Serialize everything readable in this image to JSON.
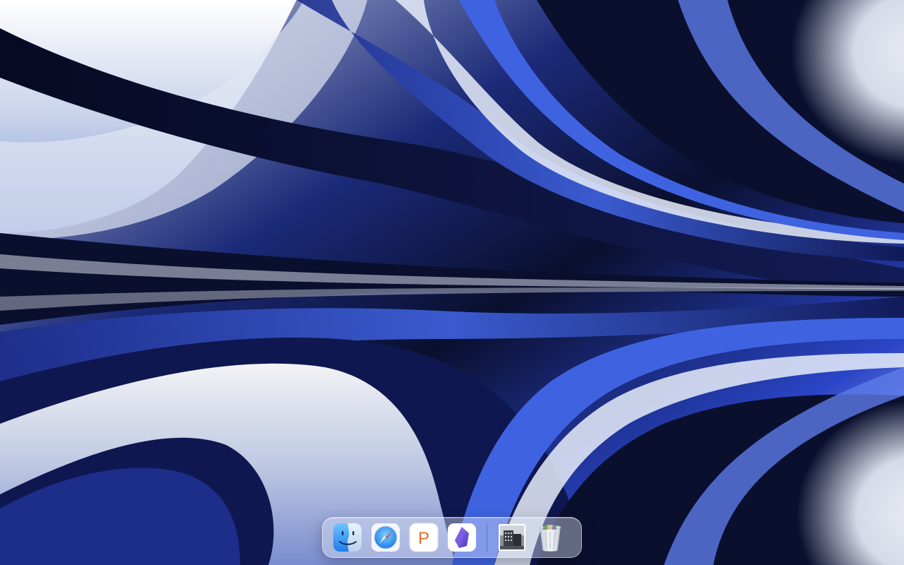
{
  "desktop": {
    "wallpaper": {
      "name": "wallpaper",
      "colors": {
        "deep_navy": "#0a0f2e",
        "royal_blue": "#2a45c8",
        "bright_blue": "#4f7bea",
        "silver": "#dfe5f2",
        "white_glow": "#f5f7fc"
      }
    }
  },
  "dock": {
    "apps": [
      {
        "id": "finder",
        "icon": "finder-icon",
        "accent": "#2f8ef3"
      },
      {
        "id": "safari",
        "icon": "safari-icon",
        "accent": "#1f7de8"
      },
      {
        "id": "pages",
        "icon": "pages-icon",
        "letter": "P",
        "accent": "#e46c2b"
      },
      {
        "id": "obsidian",
        "icon": "obsidian-icon",
        "accent": "#7c5ce6"
      }
    ],
    "others": [
      {
        "id": "photo-stack",
        "icon": "photo-stack-icon"
      },
      {
        "id": "trash",
        "icon": "trash-icon"
      }
    ]
  }
}
